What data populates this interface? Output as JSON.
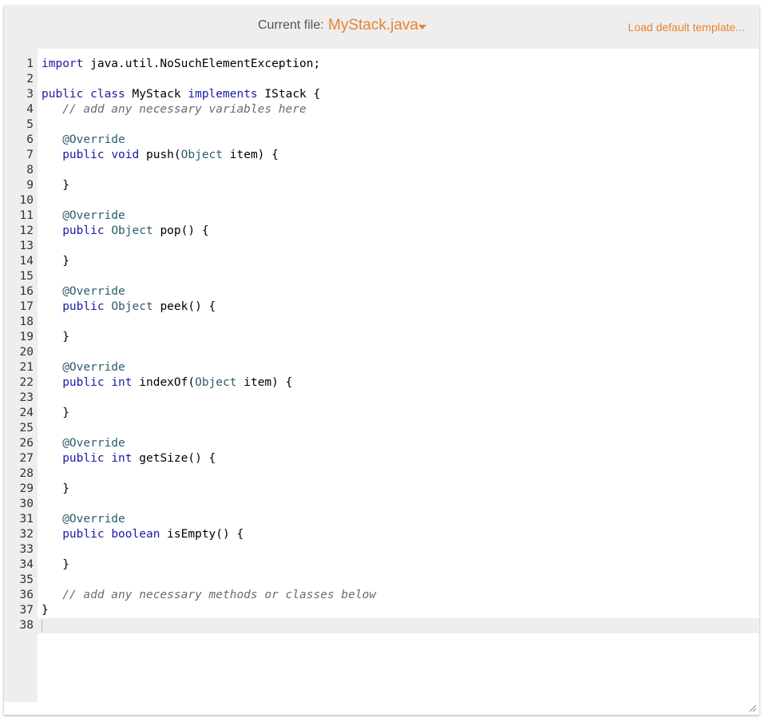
{
  "header": {
    "current_file_label": "Current file:",
    "file_name": "MyStack.java",
    "load_default": "Load default template..."
  },
  "editor": {
    "lines": [
      [
        [
          "kw",
          "import"
        ],
        [
          "p",
          " java.util.NoSuchElementException;"
        ]
      ],
      [],
      [
        [
          "kw",
          "public"
        ],
        [
          "p",
          " "
        ],
        [
          "kw",
          "class"
        ],
        [
          "p",
          " MyStack "
        ],
        [
          "kw",
          "implements"
        ],
        [
          "p",
          " IStack {"
        ]
      ],
      [
        [
          "p",
          "   "
        ],
        [
          "cm",
          "// add any necessary variables here"
        ]
      ],
      [],
      [
        [
          "p",
          "   "
        ],
        [
          "ann",
          "@Override"
        ]
      ],
      [
        [
          "p",
          "   "
        ],
        [
          "kw",
          "public"
        ],
        [
          "p",
          " "
        ],
        [
          "kw",
          "void"
        ],
        [
          "p",
          " push("
        ],
        [
          "ty",
          "Object"
        ],
        [
          "p",
          " item) {"
        ]
      ],
      [],
      [
        [
          "p",
          "   }"
        ]
      ],
      [],
      [
        [
          "p",
          "   "
        ],
        [
          "ann",
          "@Override"
        ]
      ],
      [
        [
          "p",
          "   "
        ],
        [
          "kw",
          "public"
        ],
        [
          "p",
          " "
        ],
        [
          "ty",
          "Object"
        ],
        [
          "p",
          " pop() {"
        ]
      ],
      [],
      [
        [
          "p",
          "   }"
        ]
      ],
      [],
      [
        [
          "p",
          "   "
        ],
        [
          "ann",
          "@Override"
        ]
      ],
      [
        [
          "p",
          "   "
        ],
        [
          "kw",
          "public"
        ],
        [
          "p",
          " "
        ],
        [
          "ty",
          "Object"
        ],
        [
          "p",
          " peek() {"
        ]
      ],
      [],
      [
        [
          "p",
          "   }"
        ]
      ],
      [],
      [
        [
          "p",
          "   "
        ],
        [
          "ann",
          "@Override"
        ]
      ],
      [
        [
          "p",
          "   "
        ],
        [
          "kw",
          "public"
        ],
        [
          "p",
          " "
        ],
        [
          "kw",
          "int"
        ],
        [
          "p",
          " indexOf("
        ],
        [
          "ty",
          "Object"
        ],
        [
          "p",
          " item) {"
        ]
      ],
      [],
      [
        [
          "p",
          "   }"
        ]
      ],
      [],
      [
        [
          "p",
          "   "
        ],
        [
          "ann",
          "@Override"
        ]
      ],
      [
        [
          "p",
          "   "
        ],
        [
          "kw",
          "public"
        ],
        [
          "p",
          " "
        ],
        [
          "kw",
          "int"
        ],
        [
          "p",
          " getSize() {"
        ]
      ],
      [],
      [
        [
          "p",
          "   }"
        ]
      ],
      [],
      [
        [
          "p",
          "   "
        ],
        [
          "ann",
          "@Override"
        ]
      ],
      [
        [
          "p",
          "   "
        ],
        [
          "kw",
          "public"
        ],
        [
          "p",
          " "
        ],
        [
          "kw",
          "boolean"
        ],
        [
          "p",
          " isEmpty() {"
        ]
      ],
      [],
      [
        [
          "p",
          "   }"
        ]
      ],
      [],
      [
        [
          "p",
          "   "
        ],
        [
          "cm",
          "// add any necessary methods or classes below"
        ]
      ],
      [
        [
          "p",
          "}"
        ]
      ],
      []
    ],
    "active_line": 38
  }
}
